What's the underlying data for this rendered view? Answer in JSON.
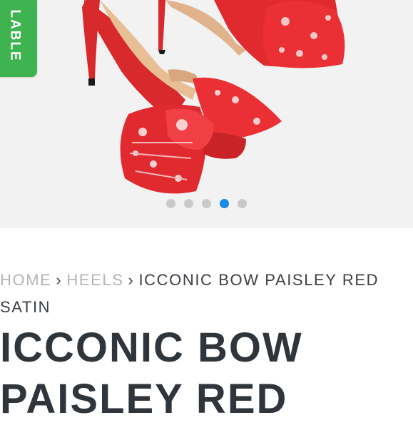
{
  "badge": {
    "text": "LABLE"
  },
  "gallery": {
    "slide_count": 5,
    "active_index": 3
  },
  "breadcrumb": {
    "home": "HOME",
    "separator": "›",
    "category": "HEELS",
    "current_line1": "ICCONIC BOW PAISLEY RED",
    "current_line2": "SATIN"
  },
  "product": {
    "title": "ICCONIC BOW\nPAISLEY RED"
  },
  "colors": {
    "badge": "#3fb34f",
    "active_dot": "#1a86e8",
    "inactive_dot": "#c9c9c9",
    "shoe_red": "#e3262b"
  }
}
